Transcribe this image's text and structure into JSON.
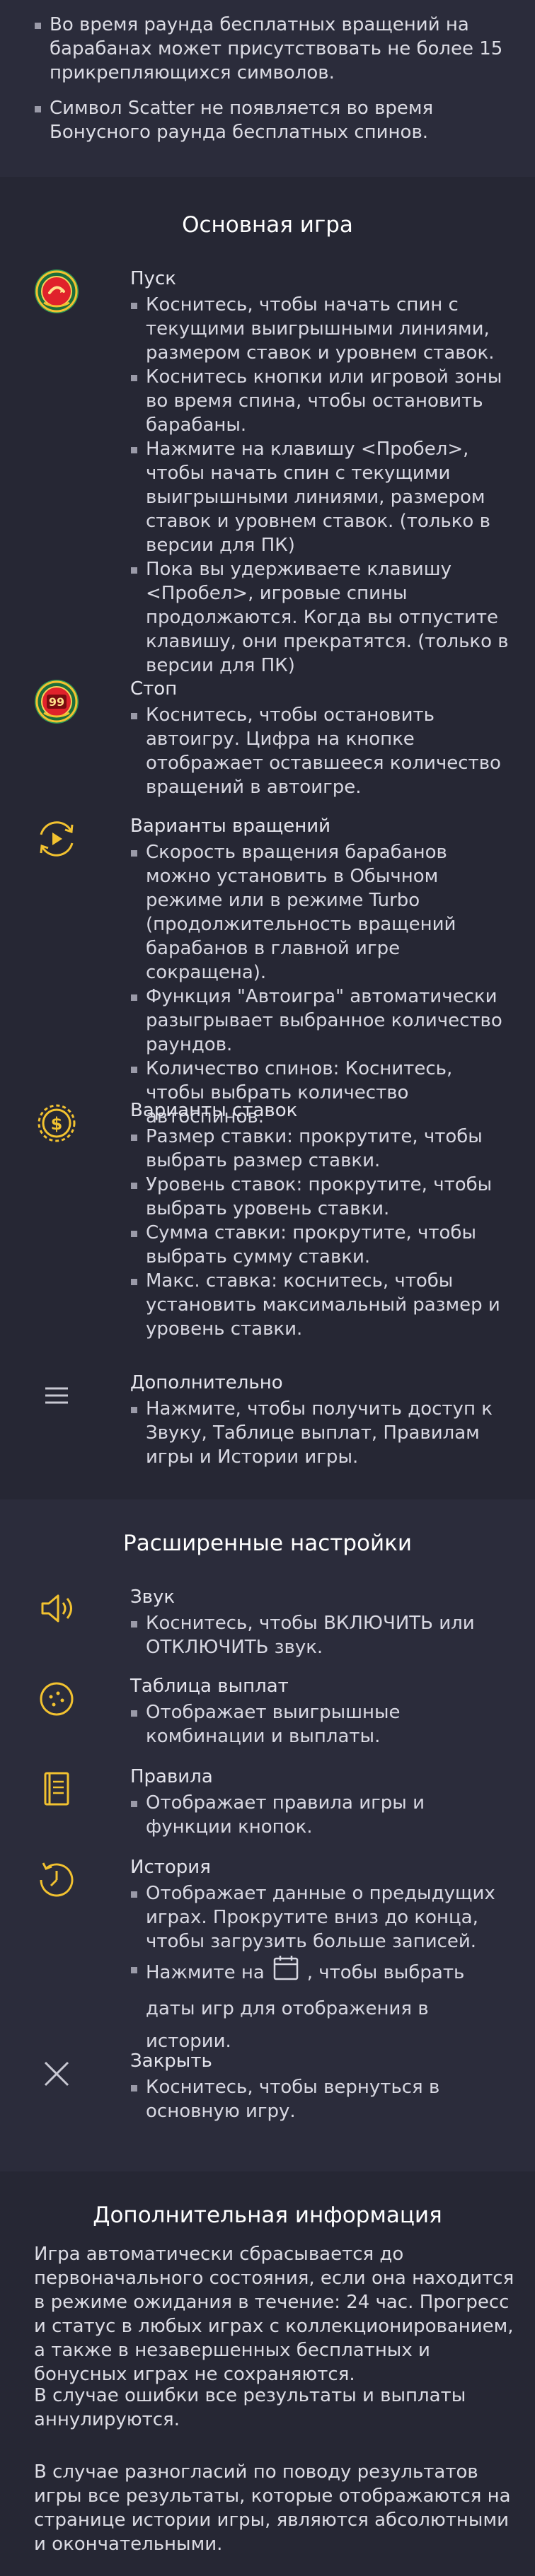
{
  "top_notes": [
    "Во время раунда бесплатных вращений на барабанах может присутствовать не более 15 прикрепляющихся символов.",
    "Символ Scatter не появляется во время Бонусного раунда бесплатных спинов."
  ],
  "main_game": {
    "title": "Основная игра",
    "items": [
      {
        "icon": "spin-button-icon",
        "title": "Пуск",
        "bullets": [
          "Коснитесь, чтобы начать спин с текущими выигрышными линиями, размером ставок и уровнем ставок.",
          "Коснитесь кнопки или игровой зоны во время спина, чтобы остановить барабаны.",
          "Нажмите на клавишу <Пробел>, чтобы начать спин с текущими выигрышными линиями, размером ставок и уровнем ставок. (только в версии для ПК)",
          "Пока вы удерживаете клавишу <Пробел>, игровые спины продолжаются. Когда вы отпустите клавишу, они прекратятся. (только в версии для ПК)"
        ]
      },
      {
        "icon": "stop-button-icon",
        "badge": "99",
        "title": "Стоп",
        "bullets": [
          "Коснитесь, чтобы остановить автоигру. Цифра на кнопке отображает оставшееся количество вращений в автоигре."
        ]
      },
      {
        "icon": "spin-options-icon",
        "title": "Варианты вращений",
        "bullets": [
          "Скорость вращения барабанов можно установить в Обычном режиме или в режиме Turbo (продолжительность вращений барабанов в главной игре сокращена).",
          "Функция \"Автоигра\" автоматически разыгрывает выбранное количество раундов.",
          "Количество спинов: Коснитесь, чтобы выбрать количество автоспинов."
        ]
      },
      {
        "icon": "bet-options-icon",
        "title": "Варианты ставок",
        "bullets": [
          "Размер ставки: прокрутите, чтобы выбрать размер ставки.",
          "Уровень ставок: прокрутите, чтобы выбрать уровень ставки.",
          "Сумма ставки: прокрутите, чтобы выбрать сумму ставки.",
          "Макс. ставка: коснитесь, чтобы установить максимальный размер и уровень ставки."
        ]
      },
      {
        "icon": "menu-icon",
        "title": "Дополнительно",
        "bullets": [
          "Нажмите, чтобы получить доступ к Звуку, Таблице выплат, Правилам игры и Истории игры."
        ]
      }
    ]
  },
  "advanced": {
    "title": "Расширенные настройки",
    "items": [
      {
        "icon": "sound-icon",
        "title": "Звук",
        "bullets": [
          "Коснитесь, чтобы ВКЛЮЧИТЬ или ОТКЛЮЧИТЬ звук."
        ]
      },
      {
        "icon": "paytable-icon",
        "title": "Таблица выплат",
        "bullets": [
          "Отображает выигрышные комбинации и выплаты."
        ]
      },
      {
        "icon": "rules-icon",
        "title": "Правила",
        "bullets": [
          "Отображает правила игры и функции кнопок."
        ]
      },
      {
        "icon": "history-icon",
        "title": "История",
        "bullets": [
          "Отображает данные о предыдущих играх. Прокрутите вниз до конца, чтобы загрузить больше записей."
        ],
        "calendar_before": "Нажмите на",
        "calendar_after": ", чтобы выбрать даты игр для отображения в истории."
      },
      {
        "icon": "close-icon",
        "title": "Закрыть",
        "bullets": [
          "Коснитесь, чтобы вернуться в основную игру."
        ]
      }
    ]
  },
  "additional": {
    "title": "Дополнительная информация",
    "paragraphs": [
      "Игра автоматически сбрасывается до первоначального состояния, если она находится в режиме ожидания в течение: 24 час. Прогресс и статус в любых играх с коллекционированием, а также в незавершенных бесплатных и бонусных играх не сохраняются.",
      "В случае ошибки все результаты и выплаты аннулируются.",
      "В случае разногласий по поводу результатов игры все результаты, которые отображаются на странице истории игры, являются абсолютными и окончательными."
    ]
  },
  "colors": {
    "accent_gold": "#f2c230",
    "icon_red": "#e0222b",
    "icon_green": "#2e9c55",
    "line_gray": "#c8c8d2"
  }
}
